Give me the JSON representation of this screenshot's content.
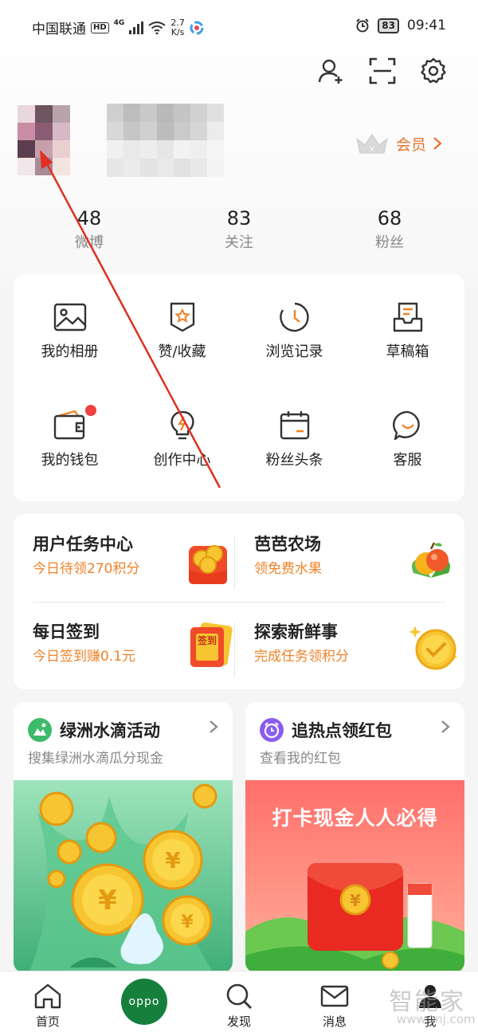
{
  "status_bar": {
    "carrier": "中国联通",
    "hd": "HD",
    "network": "4G",
    "speed_value": "2.7",
    "speed_unit": "K/s",
    "battery": "83",
    "time": "09:41"
  },
  "profile": {
    "vip_label": "会员"
  },
  "stats": [
    {
      "value": "48",
      "label": "微博"
    },
    {
      "value": "83",
      "label": "关注"
    },
    {
      "value": "68",
      "label": "粉丝"
    }
  ],
  "grid": [
    {
      "label": "我的相册",
      "icon": "album-icon"
    },
    {
      "label": "赞/收藏",
      "icon": "favorite-icon"
    },
    {
      "label": "浏览记录",
      "icon": "history-icon"
    },
    {
      "label": "草稿箱",
      "icon": "draft-box-icon"
    },
    {
      "label": "我的钱包",
      "icon": "wallet-icon"
    },
    {
      "label": "创作中心",
      "icon": "creator-bulb-icon"
    },
    {
      "label": "粉丝头条",
      "icon": "calendar-icon"
    },
    {
      "label": "客服",
      "icon": "customer-service-icon"
    }
  ],
  "tasks": [
    {
      "title": "用户任务中心",
      "sub": "今日待领270积分"
    },
    {
      "title": "芭芭农场",
      "sub": "领免费水果"
    },
    {
      "title": "每日签到",
      "sub": "今日签到赚0.1元",
      "badge": "签到"
    },
    {
      "title": "探索新鲜事",
      "sub": "完成任务领积分"
    }
  ],
  "promos": [
    {
      "title": "绿洲水滴活动",
      "sub": "搜集绿洲水滴瓜分现金"
    },
    {
      "title": "追热点领红包",
      "sub": "查看我的红包",
      "banner": "打卡现金人人必得"
    }
  ],
  "bottom_nav": [
    {
      "label": "首页"
    },
    {
      "label": "oppo"
    },
    {
      "label": "发现"
    },
    {
      "label": "消息"
    },
    {
      "label": "我"
    }
  ],
  "watermark": {
    "text": "智能家",
    "url": "www.znj.com"
  },
  "colors": {
    "accent": "#f08228",
    "vip": "#e8722a",
    "oppo": "#15803d",
    "arrow": "#e03020"
  }
}
